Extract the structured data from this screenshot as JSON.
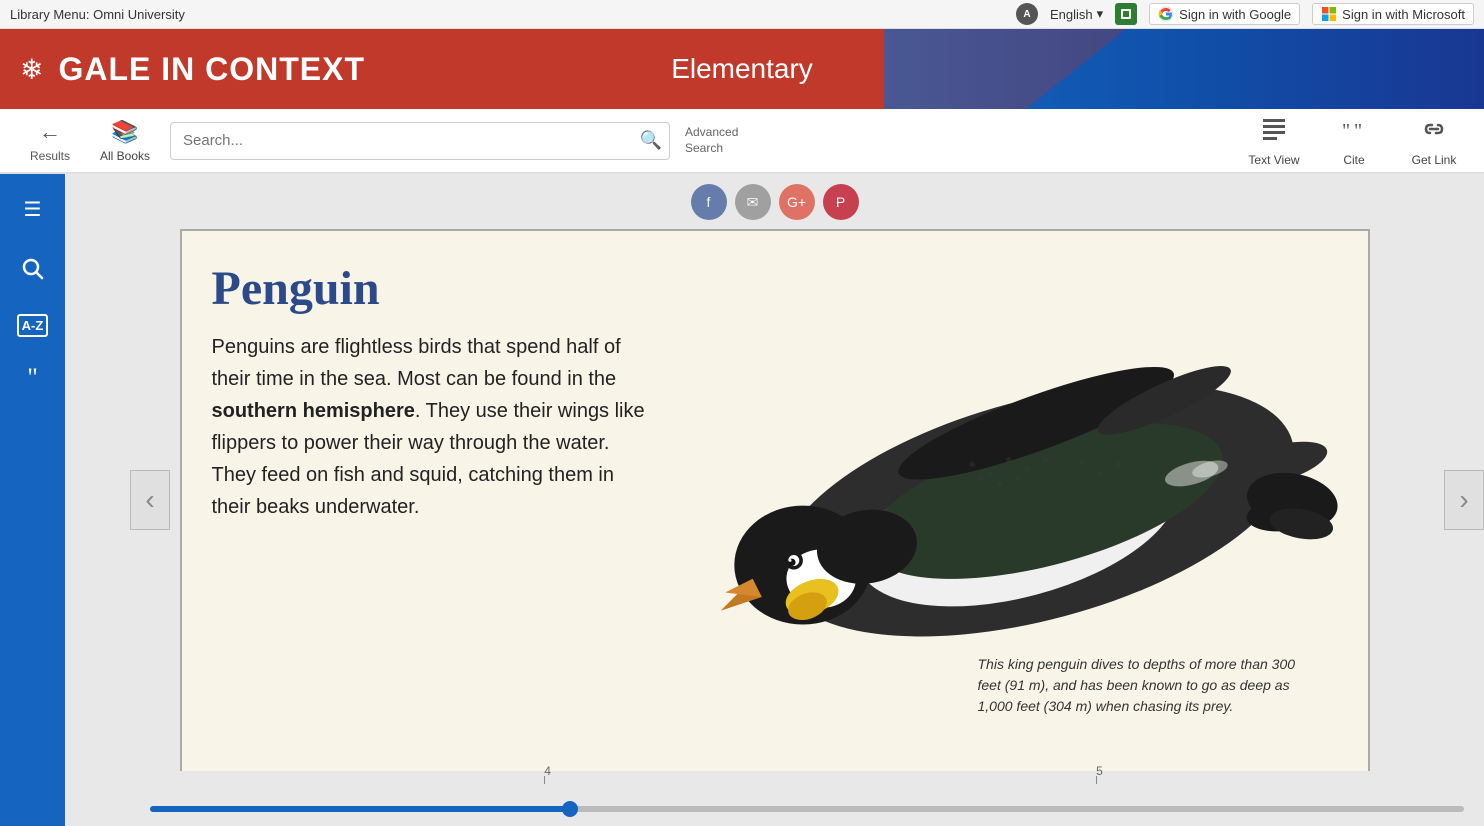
{
  "topbar": {
    "library_menu": "Library Menu: Omni University",
    "language": "English",
    "language_dropdown": "▾",
    "sign_in_google": "Sign in with Google",
    "sign_in_microsoft": "Sign in with Microsoft"
  },
  "brand": {
    "snowflake": "❄",
    "title": "GALE IN CONTEXT",
    "subtitle": "Elementary"
  },
  "toolbar": {
    "results_label": "Results",
    "all_books_label": "All Books",
    "search_placeholder": "Search...",
    "advanced_search_line1": "Advanced",
    "advanced_search_line2": "Search",
    "text_view_label": "Text View",
    "cite_label": "Cite",
    "get_link_label": "Get Link"
  },
  "share": {
    "facebook": "f",
    "email": "✉",
    "google": "G",
    "pinterest": "P"
  },
  "page": {
    "title": "Penguin",
    "body": "Penguins are flightless birds that spend half of their time in the sea. Most can be found in the southern hemisphere. They use their wings like flippers to power their way through the water. They feed on fish and squid, catching them in their beaks underwater.",
    "bold_phrase": "southern hemisphere",
    "caption": "This king penguin dives to depths of more than 300 feet (91 m), and has been known to go as deep as 1,000 feet (304 m) when chasing its prey."
  },
  "navigation": {
    "prev_arrow": "‹",
    "next_arrow": "›",
    "page4": "4",
    "page5": "5"
  },
  "sidebar_icons": {
    "menu": "☰",
    "search": "🔍",
    "glossary": "A-Z",
    "cite": "❝"
  }
}
